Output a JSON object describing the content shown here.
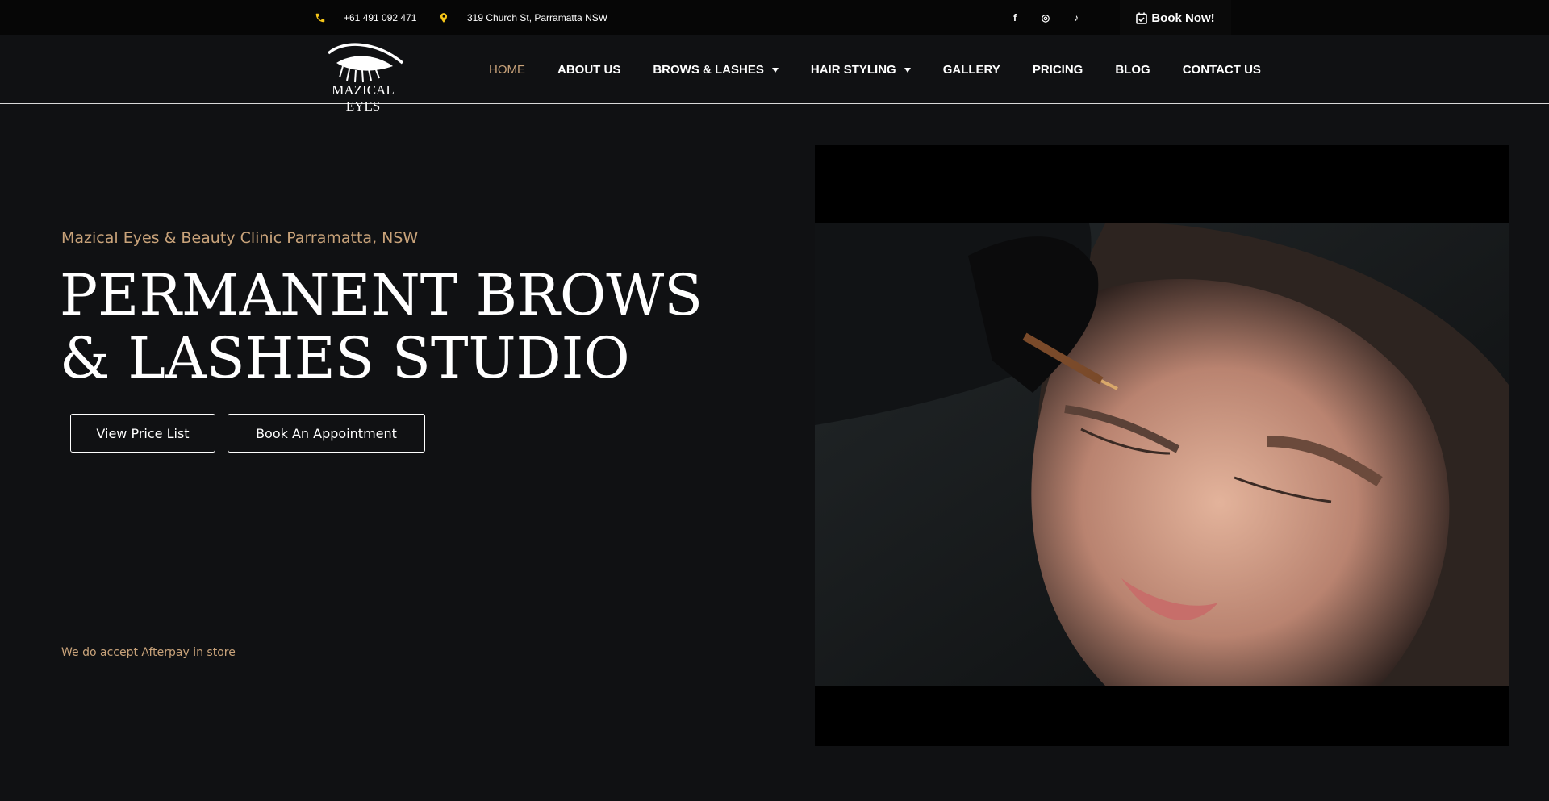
{
  "topbar": {
    "phone": "+61 491 092 471",
    "address": "319 Church St, Parramatta NSW",
    "socials": [
      {
        "icon": "facebook-icon",
        "glyph": "f"
      },
      {
        "icon": "instagram-icon",
        "glyph": "◎"
      },
      {
        "icon": "tiktok-icon",
        "glyph": "♪"
      }
    ],
    "book_now": "Book Now!"
  },
  "nav": {
    "logo_text": "MAZICAL EYES",
    "items": [
      {
        "label": "HOME",
        "active": true,
        "dropdown": false
      },
      {
        "label": "ABOUT US",
        "active": false,
        "dropdown": false
      },
      {
        "label": "BROWS & LASHES",
        "active": false,
        "dropdown": true
      },
      {
        "label": "HAIR STYLING",
        "active": false,
        "dropdown": true
      },
      {
        "label": "GALLERY",
        "active": false,
        "dropdown": false
      },
      {
        "label": "PRICING",
        "active": false,
        "dropdown": false
      },
      {
        "label": "BLOG",
        "active": false,
        "dropdown": false
      },
      {
        "label": "CONTACT US",
        "active": false,
        "dropdown": false
      }
    ]
  },
  "hero": {
    "subtitle": "Mazical Eyes & Beauty Clinic Parramatta, NSW",
    "title_line1": "PERMANENT BROWS",
    "title_line2": "& LASHES STUDIO",
    "btn_price": "View Price List",
    "btn_appointment": "Book An Appointment",
    "afterpay": "We do accept Afterpay in store"
  },
  "colors": {
    "accent": "#c9a37a",
    "icon_yellow": "#f5c518",
    "background": "#101113",
    "topbar": "#060606"
  }
}
